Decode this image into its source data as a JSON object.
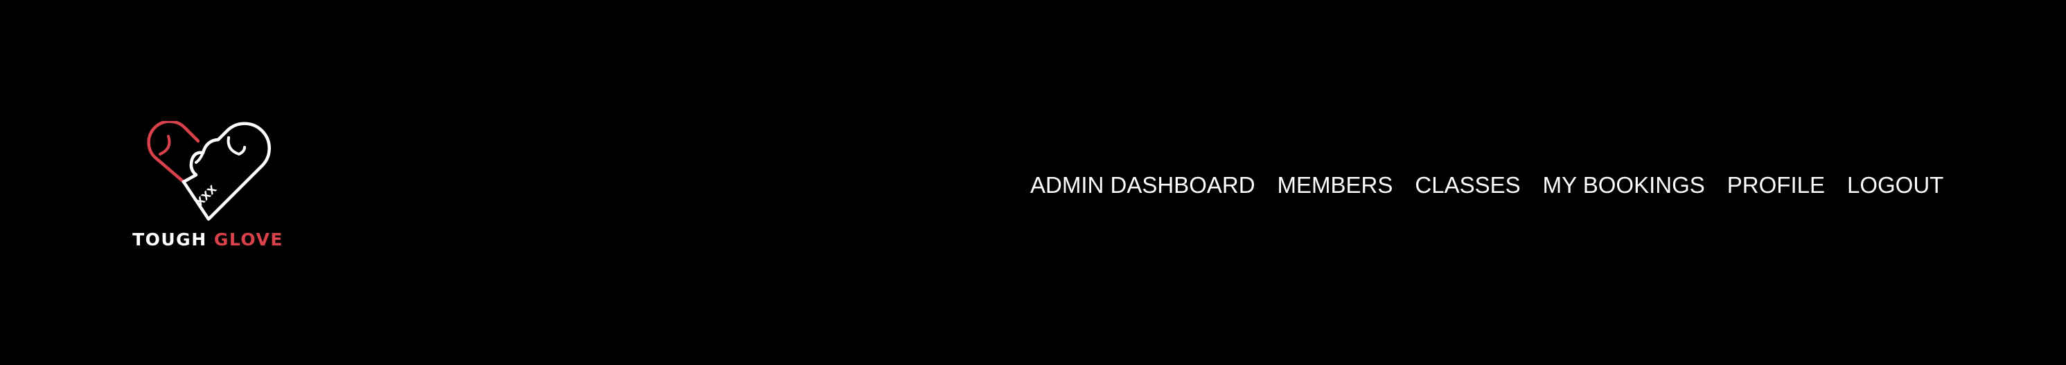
{
  "brand": {
    "word_1": "TOUGH",
    "word_2": "GLOVE",
    "logo_icon": "boxing-glove-heart-icon",
    "glove_mark": "XXX"
  },
  "colors": {
    "background": "#000000",
    "text": "#ffffff",
    "accent": "#d9414b"
  },
  "nav": {
    "items": [
      {
        "label": "ADMIN DASHBOARD"
      },
      {
        "label": "MEMBERS"
      },
      {
        "label": "CLASSES"
      },
      {
        "label": "MY BOOKINGS"
      },
      {
        "label": "PROFILE"
      },
      {
        "label": "LOGOUT"
      }
    ]
  }
}
